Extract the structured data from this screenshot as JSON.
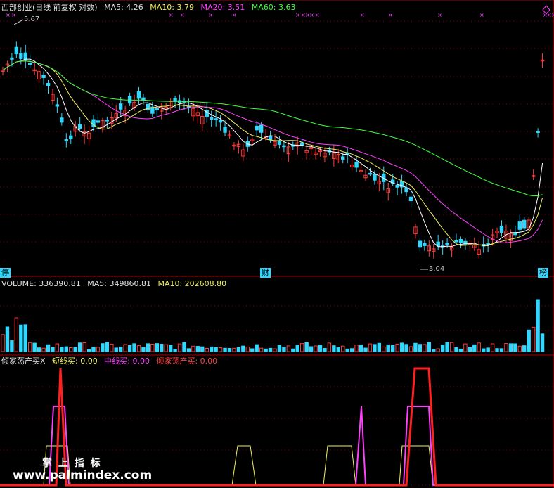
{
  "main_panel": {
    "title": "西部创业(日线 前复权 对数)",
    "ma5_label": "MA5: 4.26",
    "ma10_label": "MA10: 3.79",
    "ma20_label": "MA20: 3.51",
    "ma60_label": "MA60: 3.63",
    "high_marker": "5.67",
    "low_marker": "3.04",
    "tag_left": "停",
    "tag_mid": "财",
    "tag_right": "榜",
    "colors": {
      "up": "#ff3c3c",
      "down": "#30d8ff",
      "ma5": "#ffffff",
      "ma10": "#f0f060",
      "ma20": "#ff40ff",
      "ma60": "#40ff40",
      "grid": "#8b0000"
    }
  },
  "volume_panel": {
    "volume_label": "VOLUME: 336390.81",
    "ma5_label": "MA5: 349860.81",
    "ma10_label": "MA10: 202608.80"
  },
  "indicator_panel": {
    "name_label": "倾家荡产买X",
    "short_label": "短线买: 0.00",
    "mid_label": "中线买: 0.00",
    "all_in_label": "倾家荡产买: 0.00"
  },
  "watermark": {
    "line1": "掌 上 指 标",
    "line2": "www.palmindex.com"
  }
}
